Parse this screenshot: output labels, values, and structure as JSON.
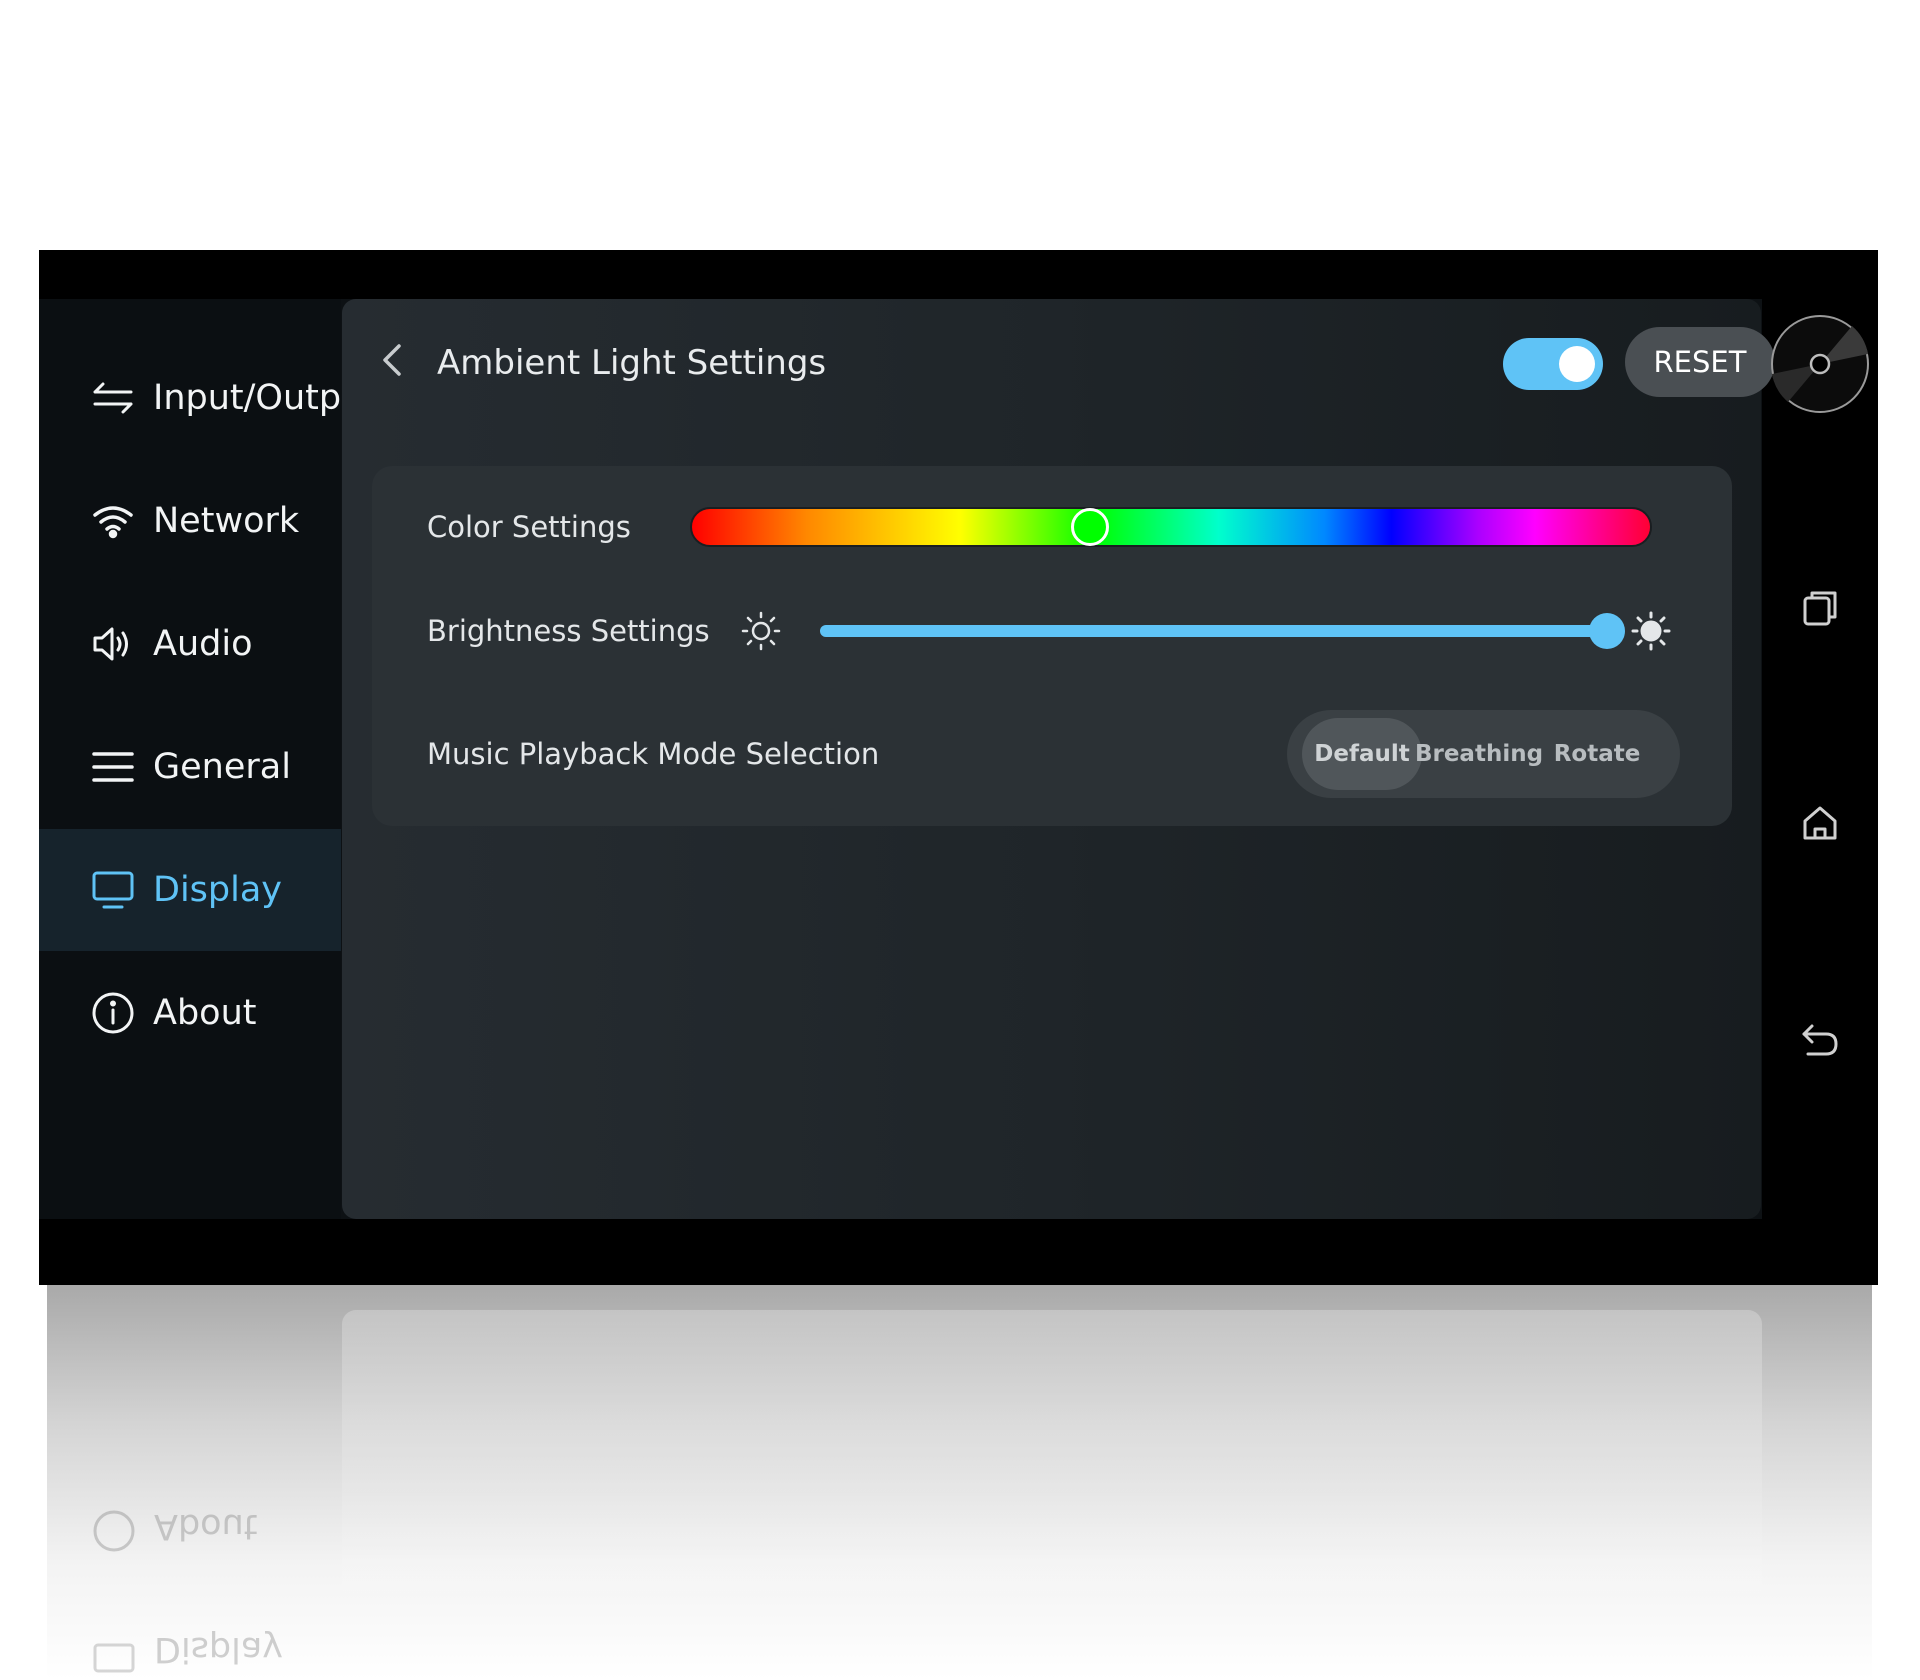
{
  "sidebar": {
    "items": [
      {
        "label": "Input/Output",
        "icon": "input-output-icon"
      },
      {
        "label": "Network",
        "icon": "wifi-icon"
      },
      {
        "label": "Audio",
        "icon": "speaker-icon"
      },
      {
        "label": "General",
        "icon": "menu-icon"
      },
      {
        "label": "Display",
        "icon": "monitor-icon",
        "active": true
      },
      {
        "label": "About",
        "icon": "info-icon"
      }
    ]
  },
  "header": {
    "title": "Ambient Light Settings",
    "toggle_on": true,
    "reset_label": "RESET"
  },
  "settings": {
    "color_label": "Color Settings",
    "color_value": 0.415,
    "brightness_label": "Brightness Settings",
    "brightness_value": 0.99,
    "mode_label": "Music Playback Mode Selection",
    "modes": [
      "Default",
      "Breathing",
      "Rotate"
    ],
    "selected_mode": "Default"
  },
  "reflection": {
    "items": [
      "About",
      "Display"
    ]
  },
  "colors": {
    "accent": "#5fc3f6",
    "background": "#0b0f12",
    "card": "#2b3135"
  }
}
